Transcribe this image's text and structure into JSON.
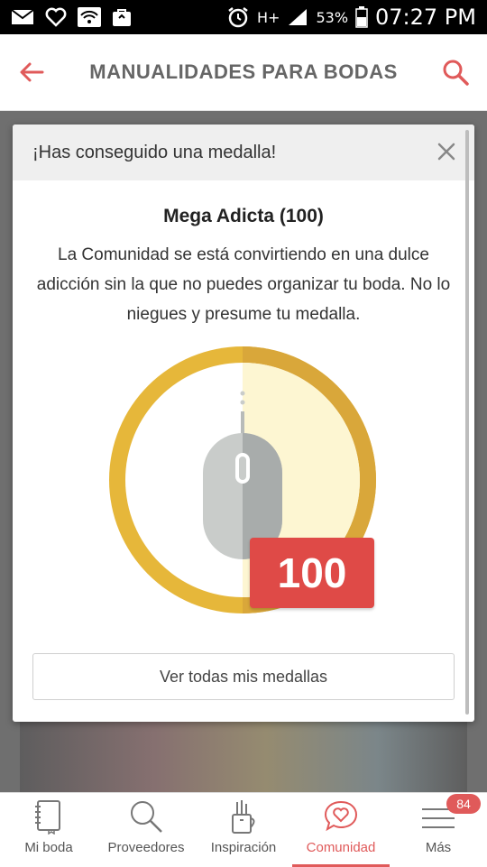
{
  "status_bar": {
    "battery": "53%",
    "time": "07:27 PM",
    "network": "H+"
  },
  "app_bar": {
    "title": "MANUALIDADES PARA BODAS"
  },
  "modal": {
    "header": "¡Has conseguido una medalla!",
    "medal_name": "Mega Adicta (100)",
    "description": "La Comunidad se está convirtiendo en una dulce adicción sin la que no puedes organizar tu boda. No lo niegues y presume tu medalla.",
    "badge_count": "100",
    "button_label": "Ver todas mis medallas"
  },
  "bottom_nav": {
    "items": [
      {
        "label": "Mi boda",
        "icon": "notebook-icon"
      },
      {
        "label": "Proveedores",
        "icon": "search-icon"
      },
      {
        "label": "Inspiración",
        "icon": "craft-cup-icon"
      },
      {
        "label": "Comunidad",
        "icon": "heart-chat-icon",
        "active": true
      },
      {
        "label": "Más",
        "icon": "menu-icon"
      }
    ],
    "more_badge": "84"
  },
  "colors": {
    "accent": "#e05a5a",
    "medal_gold": "#e6b73a",
    "count_badge": "#df4a47"
  }
}
